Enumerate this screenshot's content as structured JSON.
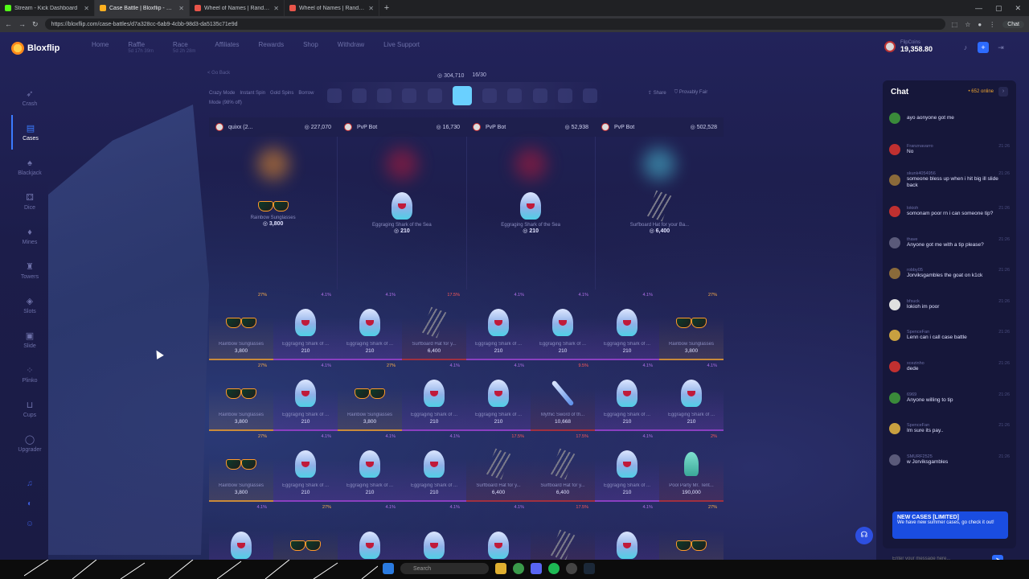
{
  "browser": {
    "tabs": [
      {
        "title": "Stream - Kick Dashboard",
        "color": "#53fc18",
        "active": false
      },
      {
        "title": "Case Battle | Bloxflip - R$ Sc...",
        "color": "#ffb020",
        "active": true
      },
      {
        "title": "Wheel of Names | Random name...",
        "color": "#e8554a",
        "active": false
      },
      {
        "title": "Wheel of Names | Random name...",
        "color": "#e8554a",
        "active": false
      }
    ],
    "url": "https://bloxflip.com/case-battles/d7a328cc-6ab9-4cbb-98d3-da5135c71e9d",
    "chat_button": "Chat"
  },
  "nav": {
    "brand": "Bloxflip",
    "links": [
      {
        "label": "Home",
        "sub": ""
      },
      {
        "label": "Raffle",
        "sub": "5d 17h 39m"
      },
      {
        "label": "Race",
        "sub": "5d 2h 28m"
      },
      {
        "label": "Affiliates",
        "sub": ""
      },
      {
        "label": "Rewards",
        "sub": ""
      },
      {
        "label": "Shop",
        "sub": ""
      },
      {
        "label": "Withdraw",
        "sub": ""
      },
      {
        "label": "Live Support",
        "sub": ""
      }
    ],
    "balance_label": "FlipCoins",
    "balance": "19,358.80"
  },
  "sidebar": {
    "items": [
      {
        "label": "Crash",
        "icon": "rocket-icon",
        "glyph": "➶",
        "active": false
      },
      {
        "label": "Cases",
        "icon": "case-icon",
        "glyph": "▤",
        "active": true
      },
      {
        "label": "Blackjack",
        "icon": "cards-icon",
        "glyph": "♠",
        "active": false
      },
      {
        "label": "Dice",
        "icon": "dice-icon",
        "glyph": "⚃",
        "active": false
      },
      {
        "label": "Mines",
        "icon": "mine-icon",
        "glyph": "♦",
        "active": false
      },
      {
        "label": "Towers",
        "icon": "tower-icon",
        "glyph": "♜",
        "active": false
      },
      {
        "label": "Slots",
        "icon": "slots-icon",
        "glyph": "◈",
        "active": false
      },
      {
        "label": "Slide",
        "icon": "slide-icon",
        "glyph": "▣",
        "active": false
      },
      {
        "label": "Plinko",
        "icon": "plinko-icon",
        "glyph": "⁘",
        "active": false
      },
      {
        "label": "Cups",
        "icon": "cup-icon",
        "glyph": "⊔",
        "active": false
      },
      {
        "label": "Upgrader",
        "icon": "upgrader-icon",
        "glyph": "◯",
        "active": false
      }
    ]
  },
  "battle": {
    "back_label": "< Go Back",
    "modes": [
      "Crazy Mode",
      "Instant Spin",
      "Gold Spins",
      "Borrow Mode (98% off)"
    ],
    "pot": "304,710",
    "round": "16/30",
    "share_label": "Share",
    "fair_label": "Provably Fair",
    "players": [
      {
        "name": "quixx (2...",
        "value": "227,070"
      },
      {
        "name": "PvP Bot",
        "value": "16,730"
      },
      {
        "name": "PvP Bot",
        "value": "52,938"
      },
      {
        "name": "PvP Bot",
        "value": "502,528"
      }
    ],
    "current": [
      {
        "name": "Rainbow Sunglasses",
        "price": "3,800",
        "kind": "sun",
        "glow": "#ff9a2a"
      },
      {
        "name": "Eggraging Shark of the Sea",
        "price": "210",
        "kind": "shark",
        "glow": "#c01a3a"
      },
      {
        "name": "Eggraging Shark of the Sea",
        "price": "210",
        "kind": "shark",
        "glow": "#c01a3a"
      },
      {
        "name": "Surfboard Hat for your Ba...",
        "price": "6,400",
        "kind": "surf",
        "glow": "#4fd0e6"
      }
    ],
    "history": [
      {
        "name": "Rainbow Sunglasses",
        "price": "3,800",
        "pct": "27%",
        "kind": "sun",
        "tier": "gold"
      },
      {
        "name": "Eggraging Shark of ...",
        "price": "210",
        "pct": "4.1%",
        "kind": "shark",
        "tier": "purple"
      },
      {
        "name": "Eggraging Shark of ...",
        "price": "210",
        "pct": "4.1%",
        "kind": "shark",
        "tier": "purple"
      },
      {
        "name": "Surfboard Hat for y...",
        "price": "6,400",
        "pct": "17.5%",
        "kind": "surf",
        "tier": "red"
      },
      {
        "name": "Eggraging Shark of ...",
        "price": "210",
        "pct": "4.1%",
        "kind": "shark",
        "tier": "purple"
      },
      {
        "name": "Eggraging Shark of ...",
        "price": "210",
        "pct": "4.1%",
        "kind": "shark",
        "tier": "purple"
      },
      {
        "name": "Eggraging Shark of ...",
        "price": "210",
        "pct": "4.1%",
        "kind": "shark",
        "tier": "purple"
      },
      {
        "name": "Rainbow Sunglasses",
        "price": "3,800",
        "pct": "27%",
        "kind": "sun",
        "tier": "gold"
      },
      {
        "name": "Rainbow Sunglasses",
        "price": "3,800",
        "pct": "27%",
        "kind": "sun",
        "tier": "gold"
      },
      {
        "name": "Eggraging Shark of ...",
        "price": "210",
        "pct": "4.1%",
        "kind": "shark",
        "tier": "purple"
      },
      {
        "name": "Rainbow Sunglasses",
        "price": "3,800",
        "pct": "27%",
        "kind": "sun",
        "tier": "gold"
      },
      {
        "name": "Eggraging Shark of ...",
        "price": "210",
        "pct": "4.1%",
        "kind": "shark",
        "tier": "purple"
      },
      {
        "name": "Eggraging Shark of ...",
        "price": "210",
        "pct": "4.1%",
        "kind": "shark",
        "tier": "purple"
      },
      {
        "name": "Mythic Sword of th...",
        "price": "10,668",
        "pct": "9.5%",
        "kind": "sword",
        "tier": "red"
      },
      {
        "name": "Eggraging Shark of ...",
        "price": "210",
        "pct": "4.1%",
        "kind": "shark",
        "tier": "purple"
      },
      {
        "name": "Eggraging Shark of ...",
        "price": "210",
        "pct": "4.1%",
        "kind": "shark",
        "tier": "purple"
      },
      {
        "name": "Rainbow Sunglasses",
        "price": "3,800",
        "pct": "27%",
        "kind": "sun",
        "tier": "gold"
      },
      {
        "name": "Eggraging Shark of ...",
        "price": "210",
        "pct": "4.1%",
        "kind": "shark",
        "tier": "purple"
      },
      {
        "name": "Eggraging Shark of ...",
        "price": "210",
        "pct": "4.1%",
        "kind": "shark",
        "tier": "purple"
      },
      {
        "name": "Eggraging Shark of ...",
        "price": "210",
        "pct": "4.1%",
        "kind": "shark",
        "tier": "purple"
      },
      {
        "name": "Surfboard Hat for y...",
        "price": "6,400",
        "pct": "17.5%",
        "kind": "surf",
        "tier": "red"
      },
      {
        "name": "Surfboard Hat for y...",
        "price": "6,400",
        "pct": "17.5%",
        "kind": "surf",
        "tier": "red"
      },
      {
        "name": "Eggraging Shark of ...",
        "price": "210",
        "pct": "4.1%",
        "kind": "shark",
        "tier": "purple"
      },
      {
        "name": "Pool Party Mr. Tent...",
        "price": "190,000",
        "pct": "2%",
        "kind": "octo",
        "tier": "red"
      },
      {
        "name": "",
        "price": "",
        "pct": "4.1%",
        "kind": "shark",
        "tier": "purple"
      },
      {
        "name": "",
        "price": "",
        "pct": "27%",
        "kind": "sun",
        "tier": "gold"
      },
      {
        "name": "",
        "price": "",
        "pct": "4.1%",
        "kind": "shark",
        "tier": "purple"
      },
      {
        "name": "",
        "price": "",
        "pct": "4.1%",
        "kind": "shark",
        "tier": "purple"
      },
      {
        "name": "",
        "price": "",
        "pct": "4.1%",
        "kind": "shark",
        "tier": "purple"
      },
      {
        "name": "",
        "price": "",
        "pct": "17.5%",
        "kind": "surf",
        "tier": "red"
      },
      {
        "name": "",
        "price": "",
        "pct": "4.1%",
        "kind": "shark",
        "tier": "purple"
      },
      {
        "name": "",
        "price": "",
        "pct": "27%",
        "kind": "sun",
        "tier": "gold"
      }
    ]
  },
  "chat": {
    "title": "Chat",
    "online": "• 652 online",
    "messages": [
      {
        "user": "",
        "time": "",
        "text": "ayo aonyone got me",
        "color": "#3a8a3a"
      },
      {
        "user": "Franznavarro",
        "time": "21:26",
        "text": "No",
        "color": "#c03030"
      },
      {
        "user": "skunk4054956",
        "time": "21:26",
        "text": "someone bless up when i hit big ill slide back",
        "color": "#8a6a3a"
      },
      {
        "user": "lokioh",
        "time": "21:26",
        "text": "somonam poor rn i can someone tip?",
        "color": "#c03030"
      },
      {
        "user": "thave",
        "time": "21:26",
        "text": "Anyone got me with a tip please?",
        "color": "#5a5a7a"
      },
      {
        "user": "robby05",
        "time": "21:26",
        "text": "Jorviksgambles the goat on k1ck",
        "color": "#8a6a3a"
      },
      {
        "user": "bfsuck",
        "time": "21:26",
        "text": "lokioh im poor",
        "color": "#e0e0e0"
      },
      {
        "user": "SpenceFan",
        "time": "21:26",
        "text": "Lenn can i call case battle",
        "color": "#c8a040"
      },
      {
        "user": "xcezinho",
        "time": "21:26",
        "text": "dede",
        "color": "#c03030"
      },
      {
        "user": "6969",
        "time": "21:26",
        "text": "Anyone willing to tip",
        "color": "#3a8a3a"
      },
      {
        "user": "SpenceFan",
        "time": "21:26",
        "text": "Im sure its pay..",
        "color": "#c8a040"
      },
      {
        "user": "SMURF2525",
        "time": "21:26",
        "text": "w Jorviksgambles",
        "color": "#5a5a7a"
      }
    ],
    "promo_title": "NEW CASES [LIMITED]",
    "promo_text": "We have new summer cases, go check it out!",
    "input_placeholder": "Enter your message here..."
  },
  "taskbar": {
    "search": "Search"
  }
}
